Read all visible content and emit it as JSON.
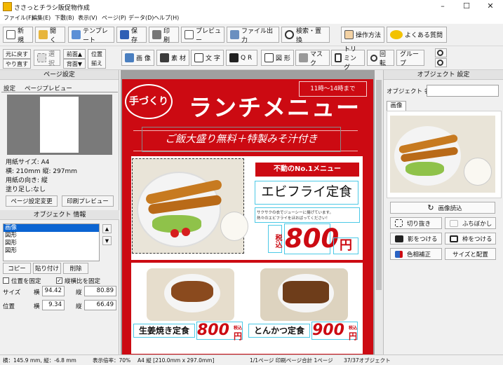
{
  "window": {
    "title": "ささっとチラシ販促物作成",
    "minimize": "–",
    "maximize": "☐",
    "close": "✕"
  },
  "menu": [
    "ファイル(F)",
    "編集(E)",
    "下敷(B)",
    "表示(V)",
    "ページ(P)",
    "データ(D)",
    "ヘルプ(H)"
  ],
  "toolbar": {
    "new": "新規",
    "open": "開く",
    "template": "テンプレート",
    "save": "保存",
    "print": "印刷",
    "preview": "プレビュー",
    "export": "ファイル出力",
    "search": "検索・置換",
    "howto": "操作方法",
    "faq": "よくある質問"
  },
  "toolbar2": {
    "undo": "元に戻す",
    "redo": "やり直す",
    "select": "選択",
    "front": "前面▲",
    "back": "背面▼",
    "align_top": "位置",
    "align_bottom": "揃え",
    "image": "画 像",
    "material": "素 材",
    "text": "文 字",
    "qr": "Q R",
    "shape": "図 形",
    "mask": "マスク",
    "trim": "トリミング",
    "rotate": "回転",
    "group": "グループ"
  },
  "left_panel": {
    "page_settings_title": "ページ設定",
    "tab_settings": "設定",
    "tab_preview": "ページプレビュー",
    "paper_size": "用紙サイズ: A4",
    "dims": "横: 210mm  縦: 297mm",
    "orientation": "用紙の向き: 縦",
    "bleed": "塗り足し:なし",
    "change_page_button": "ページ設定変更",
    "print_preview_button": "印刷プレビュー",
    "object_info_title": "オブジェクト 情報",
    "object_list": [
      "画像",
      "図形",
      "図形",
      "図形"
    ],
    "copy_button": "コピー",
    "paste_button": "貼り付け",
    "delete_button": "削除",
    "fix_position": "位置を固定",
    "fix_ratio": "縦横比を固定",
    "size_label": "サイズ",
    "position_label": "位置",
    "width_label": "横",
    "height_label": "縦",
    "size_w": "94.42",
    "size_h": "80.89",
    "pos_x": "9.34",
    "pos_y": "66.49"
  },
  "flyer": {
    "hours": "11時～14時まで",
    "logo": "手づくり",
    "title": "ランチメニュー",
    "banner": "ご飯大盛り無料＋特製みそ汁付き",
    "no1": "不動のNo.1メニュー",
    "dish_name": "エビフライ定食",
    "dish_desc_1": "サクサクの衣でジューシーに揚げています。",
    "dish_desc_2": "熱々のエビフライをほおばってください！",
    "tax_label": "税込",
    "price_main": "800",
    "yen": "円",
    "item2_name": "生姜焼き定食",
    "item2_price": "800",
    "item3_name": "とんかつ定食",
    "item3_price": "900",
    "tax_small": "税込"
  },
  "right_panel": {
    "title": "オブジェクト 設定",
    "name_label": "オブジェクト 名",
    "name_value": "",
    "tab_image": "画像",
    "reload_button": "画像読込",
    "cutout_button": "切り抜き",
    "blur_button": "ふちぼかし",
    "shadow_button": "影をつける",
    "frame_button": "枠をつける",
    "color_button": "色相補正",
    "size_button": "サイズと配置"
  },
  "status": {
    "coords": "横：145.9 mm, 縦：-6.8 mm",
    "zoom": "表示倍率：70%",
    "paper": "A4 縦 [210.0mm x 297.0mm]",
    "pages": "1/1ページ 印刷ページ合計 1ページ",
    "objects": "37/37オブジェクト"
  },
  "colors": {
    "flyer_red": "#cc0a12",
    "accent_blue": "#2a64c4",
    "select_blue": "#0a64d2",
    "cyan": "#4cc9e6"
  }
}
